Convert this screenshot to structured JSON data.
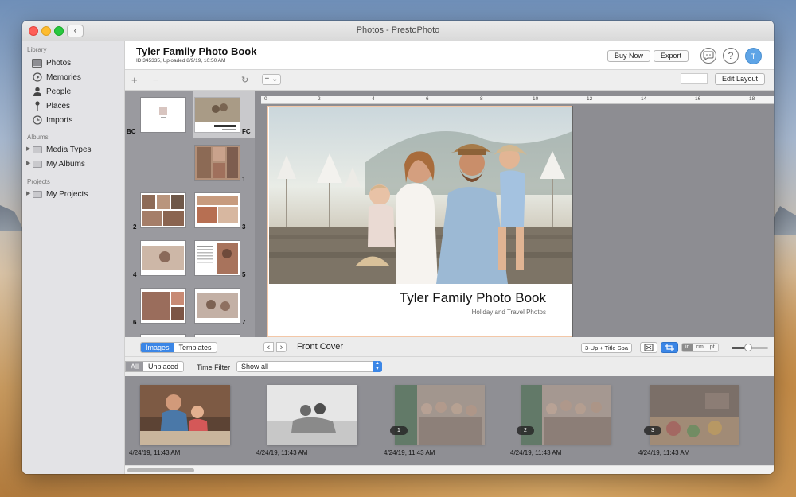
{
  "window": {
    "title": "Photos - PrestoPhoto"
  },
  "sidebar": {
    "sections": [
      {
        "label": "Library",
        "items": [
          {
            "label": "Photos",
            "icon": "photos-icon"
          },
          {
            "label": "Memories",
            "icon": "memories-icon"
          },
          {
            "label": "People",
            "icon": "people-icon"
          },
          {
            "label": "Places",
            "icon": "pin-icon"
          },
          {
            "label": "Imports",
            "icon": "clock-icon"
          }
        ]
      },
      {
        "label": "Albums",
        "items": [
          {
            "label": "Media Types",
            "icon": "folder-icon"
          },
          {
            "label": "My Albums",
            "icon": "folder-icon"
          }
        ]
      },
      {
        "label": "Projects",
        "items": [
          {
            "label": "My Projects",
            "icon": "folder-icon"
          }
        ]
      }
    ]
  },
  "header": {
    "title": "Tyler Family Photo Book",
    "subtitle": "ID 345335, Uploaded 8/9/19, 10:50 AM",
    "buy_label": "Buy Now",
    "export_label": "Export",
    "avatar_initial": "T"
  },
  "toolbar": {
    "add_label": "+",
    "remove_label": "−",
    "add_menu_label": "+ ⌄",
    "edit_layout_label": "Edit Layout"
  },
  "pages": {
    "back_cover_label": "BC",
    "front_cover_label": "FC",
    "page_numbers": [
      "1",
      "2",
      "3",
      "4",
      "5",
      "6",
      "7"
    ]
  },
  "ruler": {
    "labels": [
      "0",
      "2",
      "4",
      "6",
      "8",
      "10",
      "12",
      "14",
      "16",
      "18"
    ]
  },
  "canvas": {
    "title": "Tyler Family Photo Book",
    "subtitle": "Holiday and Travel Photos"
  },
  "bottom_bar": {
    "tabs": [
      {
        "label": "Images",
        "active": true
      },
      {
        "label": "Templates",
        "active": false
      }
    ],
    "current_page": "Front Cover",
    "layout_name": "3-Up + Title Spa",
    "units": [
      {
        "label": "in",
        "active": true
      },
      {
        "label": "cm",
        "active": false
      },
      {
        "label": "pt",
        "active": false
      }
    ],
    "zoom_fraction": 0.45
  },
  "filter_bar": {
    "tabs": [
      {
        "label": "All",
        "active": true
      },
      {
        "label": "Unplaced",
        "active": false
      }
    ],
    "time_filter_label": "Time Filter",
    "time_filter_value": "Show all"
  },
  "strip": {
    "items": [
      {
        "date": "4/24/19, 11:43 AM",
        "badge": "",
        "dim": false
      },
      {
        "date": "4/24/19, 11:43 AM",
        "badge": "",
        "dim": false
      },
      {
        "date": "4/24/19, 11:43 AM",
        "badge": "1",
        "dim": true
      },
      {
        "date": "4/24/19, 11:43 AM",
        "badge": "2",
        "dim": true
      },
      {
        "date": "4/24/19, 11:43 AM",
        "badge": "3",
        "dim": true
      }
    ]
  },
  "colors": {
    "accent": "#3b86e6",
    "canvas_border": "#f3c7a7"
  }
}
